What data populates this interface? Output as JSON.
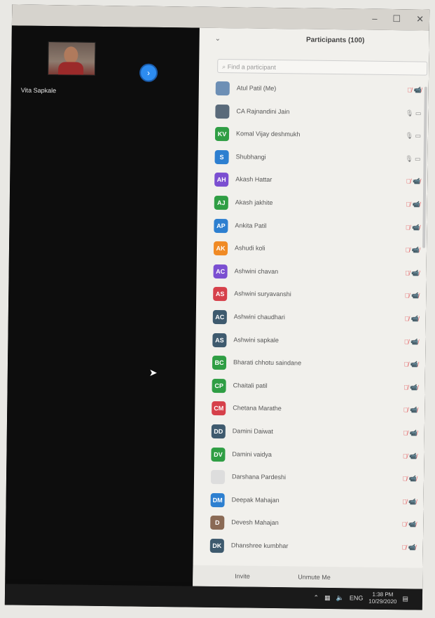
{
  "window": {
    "controls": [
      "–",
      "☐",
      "✕"
    ]
  },
  "video": {
    "participant_name": "Vita Sapkale"
  },
  "panel": {
    "title": "Participants (100)",
    "search_placeholder": "Find a participant",
    "invite_label": "Invite",
    "unmute_label": "Unmute Me"
  },
  "participants": [
    {
      "name": "Atul Patil (Me)",
      "initials": "",
      "color": "#6d8fb5",
      "muted": true
    },
    {
      "name": "CA Rajnandini Jain",
      "initials": "",
      "color": "#5a6a7a",
      "muted": false
    },
    {
      "name": "Komal Vijay deshmukh",
      "initials": "KV",
      "color": "#2f9e44",
      "muted": false
    },
    {
      "name": "Shubhangi",
      "initials": "S",
      "color": "#2d7fd0",
      "muted": false
    },
    {
      "name": "Akash Hattar",
      "initials": "AH",
      "color": "#7b4fd1",
      "muted": true
    },
    {
      "name": "Akash jakhite",
      "initials": "AJ",
      "color": "#2f9e44",
      "muted": true
    },
    {
      "name": "Ankita Patil",
      "initials": "AP",
      "color": "#2d7fd0",
      "muted": true
    },
    {
      "name": "Ashudi koli",
      "initials": "AK",
      "color": "#f08a24",
      "muted": true
    },
    {
      "name": "Ashwini chavan",
      "initials": "AC",
      "color": "#7b4fd1",
      "muted": true
    },
    {
      "name": "Ashwini suryavanshi",
      "initials": "AS",
      "color": "#d6404a",
      "muted": true
    },
    {
      "name": "Ashwini chaudhari",
      "initials": "AC",
      "color": "#3e5a6e",
      "muted": true
    },
    {
      "name": "Ashwini sapkale",
      "initials": "AS",
      "color": "#3e5a6e",
      "muted": true
    },
    {
      "name": "Bharati chhotu saindane",
      "initials": "BC",
      "color": "#2f9e44",
      "muted": true
    },
    {
      "name": "Chaitali patil",
      "initials": "CP",
      "color": "#2f9e44",
      "muted": true
    },
    {
      "name": "Chetana Marathe",
      "initials": "CM",
      "color": "#d6404a",
      "muted": true
    },
    {
      "name": "Damini Daiwat",
      "initials": "DD",
      "color": "#3e5a6e",
      "muted": true
    },
    {
      "name": "Damini vaidya",
      "initials": "DV",
      "color": "#2f9e44",
      "muted": true
    },
    {
      "name": "Darshana Pardeshi",
      "initials": "",
      "color": "#dddddd",
      "muted": true
    },
    {
      "name": "Deepak Mahajan",
      "initials": "DM",
      "color": "#2d7fd0",
      "muted": true
    },
    {
      "name": "Devesh Mahajan",
      "initials": "D",
      "color": "#8a6a55",
      "muted": true
    },
    {
      "name": "Dhanshree kumbhar",
      "initials": "DK",
      "color": "#3e5a6e",
      "muted": true
    }
  ],
  "status_icons": {
    "muted": "🎙̸ 📹̸",
    "unmuted": "🎙 ▭"
  },
  "taskbar": {
    "lang": "ENG",
    "time": "1:38 PM",
    "date": "10/29/2020"
  }
}
